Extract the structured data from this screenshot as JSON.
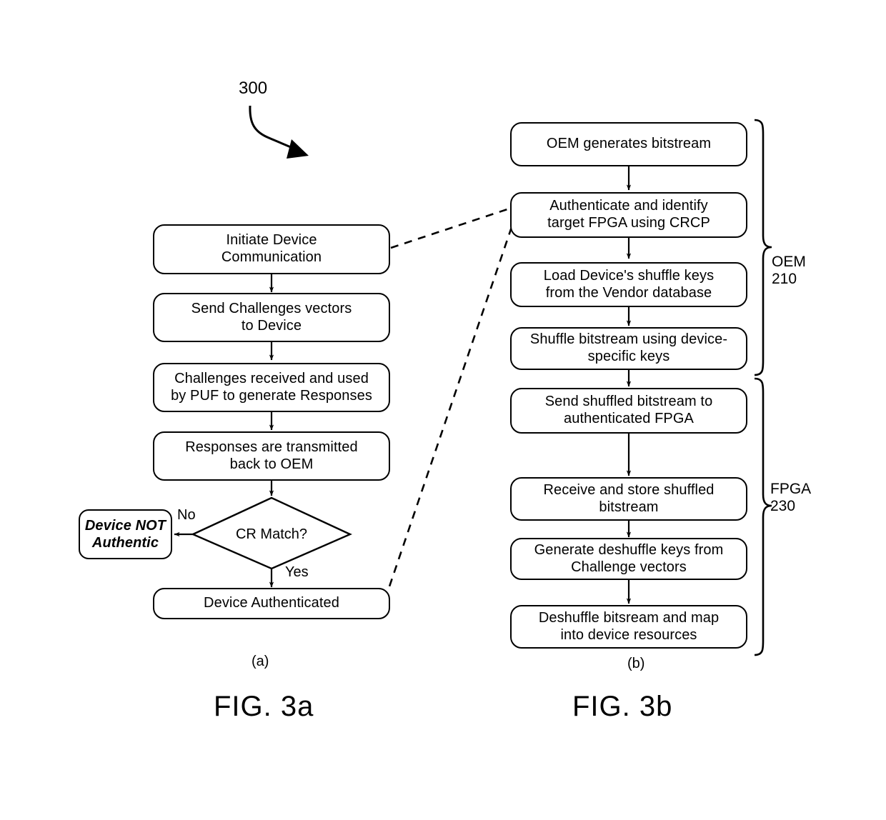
{
  "figure": {
    "reference_numeral": "300",
    "left_caption": "FIG. 3a",
    "right_caption": "FIG. 3b",
    "left_sublabel": "(a)",
    "right_sublabel": "(b)"
  },
  "left_flow": {
    "nodes": [
      {
        "id": "initiate",
        "text": "Initiate Device\nCommunication"
      },
      {
        "id": "send-challenges",
        "text": "Send Challenges vectors\nto Device"
      },
      {
        "id": "challenges-received",
        "text": "Challenges received and used\nby PUF to generate Responses"
      },
      {
        "id": "responses-transmitted",
        "text": "Responses are transmitted\nback to OEM"
      },
      {
        "id": "device-authenticated",
        "text": "Device Authenticated"
      }
    ],
    "decision": {
      "id": "cr-match",
      "text": "CR Match?"
    },
    "reject_node": {
      "id": "device-not-authentic",
      "text": "Device NOT\nAuthentic"
    },
    "edge_labels": {
      "no": "No",
      "yes": "Yes"
    }
  },
  "right_flow": {
    "nodes": [
      {
        "id": "oem-generates",
        "text": "OEM generates bitstream"
      },
      {
        "id": "authenticate-identify",
        "text": "Authenticate and identify\ntarget FPGA using CRCP"
      },
      {
        "id": "load-shuffle-keys",
        "text": "Load Device's shuffle keys\nfrom the Vendor database"
      },
      {
        "id": "shuffle-bitstream",
        "text": "Shuffle bitstream using device-\nspecific keys"
      },
      {
        "id": "send-shuffled",
        "text": "Send shuffled bitstream to\nauthenticated FPGA"
      },
      {
        "id": "receive-store",
        "text": "Receive and store shuffled\nbitstream"
      },
      {
        "id": "generate-deshuffle-keys",
        "text": "Generate deshuffle keys from\nChallenge vectors"
      },
      {
        "id": "deshuffle-map",
        "text": "Deshuffle bitsream and map\ninto device resources"
      }
    ],
    "groups": [
      {
        "id": "oem-group",
        "label": "OEM\n210"
      },
      {
        "id": "fpga-group",
        "label": "FPGA\n230"
      }
    ]
  },
  "colors": {
    "stroke": "#000000",
    "background": "#ffffff"
  }
}
